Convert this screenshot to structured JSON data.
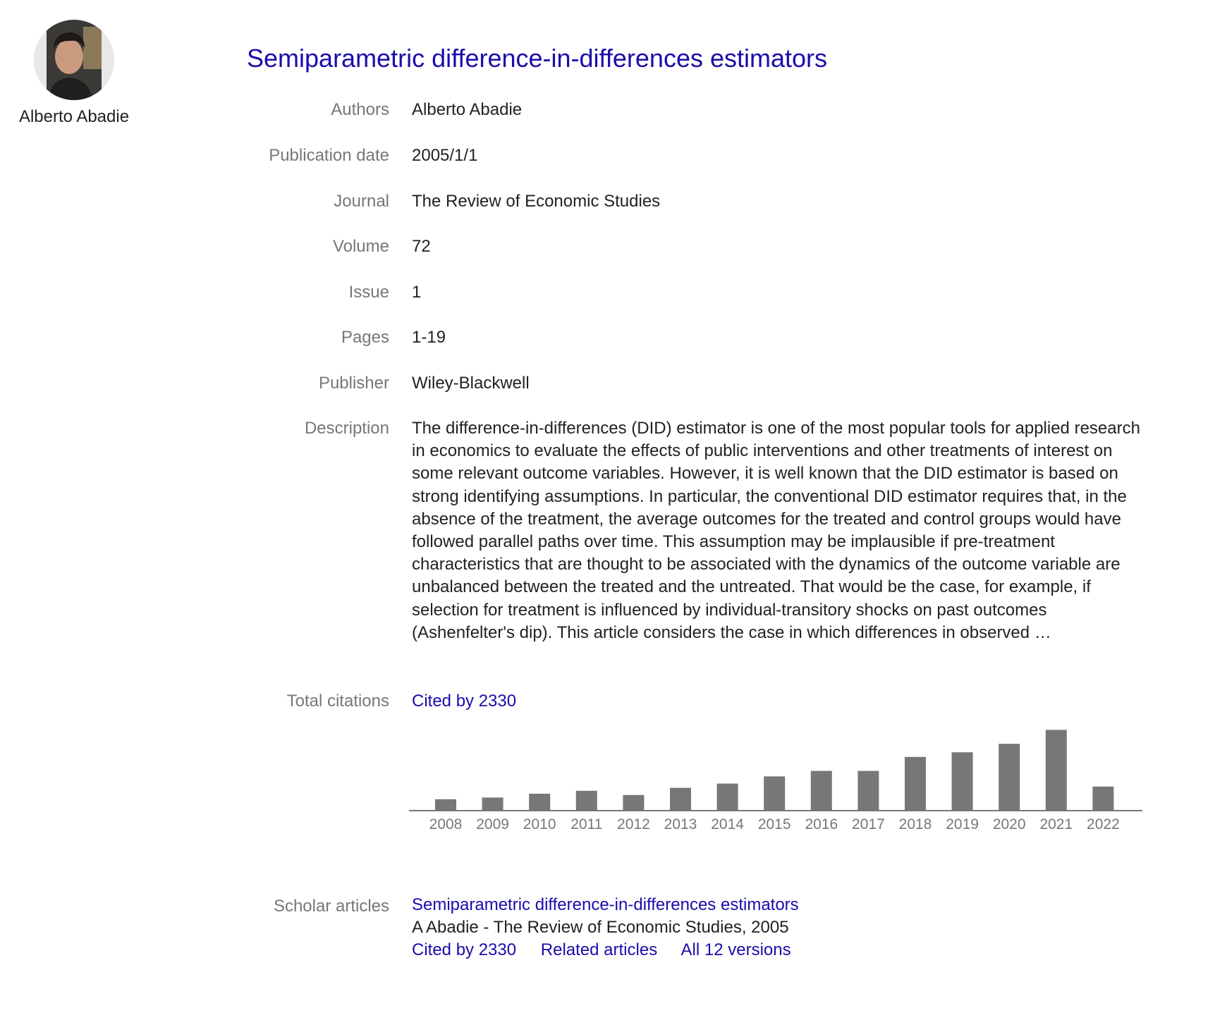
{
  "profile": {
    "name": "Alberto Abadie"
  },
  "article": {
    "title": "Semiparametric difference-in-differences estimators"
  },
  "fields": {
    "authors": {
      "label": "Authors",
      "value": "Alberto Abadie"
    },
    "publication_date": {
      "label": "Publication date",
      "value": "2005/1/1"
    },
    "journal": {
      "label": "Journal",
      "value": "The Review of Economic Studies"
    },
    "volume": {
      "label": "Volume",
      "value": "72"
    },
    "issue": {
      "label": "Issue",
      "value": "1"
    },
    "pages": {
      "label": "Pages",
      "value": "1-19"
    },
    "publisher": {
      "label": "Publisher",
      "value": "Wiley-Blackwell"
    },
    "description": {
      "label": "Description",
      "value": "The difference-in-differences (DID) estimator is one of the most popular tools for applied research in economics to evaluate the effects of public interventions and other treatments of interest on some relevant outcome variables. However, it is well known that the DID estimator is based on strong identifying assumptions. In particular, the conventional DID estimator requires that, in the absence of the treatment, the average outcomes for the treated and control groups would have followed parallel paths over time. This assumption may be implausible if pre-treatment characteristics that are thought to be associated with the dynamics of the outcome variable are unbalanced between the treated and the untreated. That would be the case, for example, if selection for treatment is influenced by individual-transitory shocks on past outcomes (Ashenfelter's dip). This article considers the case in which differences in observed …"
    },
    "total_citations": {
      "label": "Total citations",
      "value": "Cited by 2330"
    }
  },
  "chart_data": {
    "type": "bar",
    "title": "",
    "xlabel": "",
    "ylabel": "",
    "categories": [
      "2008",
      "2009",
      "2010",
      "2011",
      "2012",
      "2013",
      "2014",
      "2015",
      "2016",
      "2017",
      "2018",
      "2019",
      "2020",
      "2021",
      "2022"
    ],
    "values": [
      27,
      31,
      40,
      47,
      37,
      54,
      64,
      81,
      94,
      94,
      127,
      138,
      158,
      191,
      57
    ],
    "ylim": [
      0,
      200
    ],
    "bar_color": "#777777",
    "axis_color": "#777777",
    "grid": false
  },
  "scholar": {
    "label": "Scholar articles",
    "title": "Semiparametric difference-in-differences estimators",
    "meta": "A Abadie - The Review of Economic Studies, 2005",
    "links": {
      "cited_by": "Cited by 2330",
      "related": "Related articles",
      "versions": "All 12 versions"
    }
  },
  "colors": {
    "link": "#1a0dab",
    "label": "#777777",
    "text": "#222222"
  }
}
